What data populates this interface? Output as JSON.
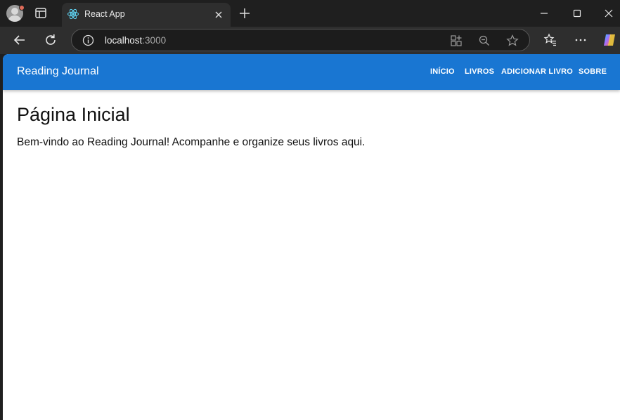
{
  "browser": {
    "tab": {
      "title": "React App",
      "favicon": "react-logo-icon"
    },
    "address": {
      "host": "localhost",
      "port": ":3000"
    },
    "icons": [
      "profile-avatar",
      "tab-actions-icon",
      "close-icon",
      "plus-icon",
      "minimize-icon",
      "maximize-icon",
      "window-close-icon",
      "back-arrow-icon",
      "reload-icon",
      "info-icon",
      "app-available-icon",
      "zoom-out-icon",
      "star-icon",
      "favorites-icon",
      "more-icon",
      "copilot-icon"
    ]
  },
  "app": {
    "brand": "Reading Journal",
    "nav": [
      {
        "label": "INÍCIO"
      },
      {
        "label": "LIVROS"
      },
      {
        "label": "ADICIONAR LIVRO"
      },
      {
        "label": "SOBRE"
      }
    ],
    "colors": {
      "appbar": "#1976d2",
      "text": "#111111"
    }
  },
  "page": {
    "title": "Página Inicial",
    "welcome": "Bem-vindo ao Reading Journal! Acompanhe e organize seus livros aqui."
  }
}
